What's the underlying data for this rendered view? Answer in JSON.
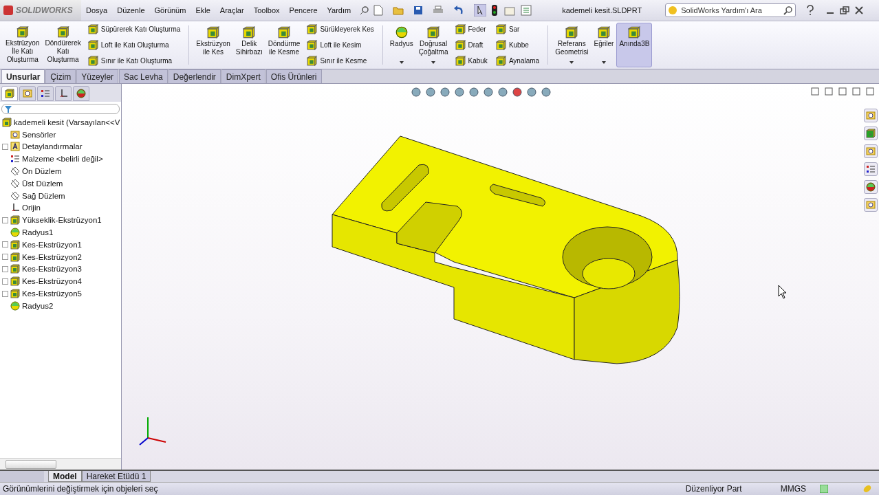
{
  "app": {
    "logo": "SOLIDWORKS"
  },
  "menu": [
    "Dosya",
    "Düzenle",
    "Görünüm",
    "Ekle",
    "Araçlar",
    "Toolbox",
    "Pencere",
    "Yardım"
  ],
  "document_title": "kademeli kesit.SLDPRT",
  "search": {
    "placeholder": "SolidWorks Yardım'ı Ara"
  },
  "ribbon": [
    {
      "kind": "large",
      "label": "Ekstrüzyon\nİle Katı\nOluşturma",
      "selected": false
    },
    {
      "kind": "large",
      "label": "Döndürerek\nKatı\nOluşturma",
      "selected": false
    },
    {
      "kind": "stack",
      "items": [
        "Süpürerek Katı Oluşturma",
        "Loft ile Katı Oluşturma",
        "Sınır ile Katı Oluşturma"
      ]
    },
    {
      "kind": "separator"
    },
    {
      "kind": "large",
      "label": "Ekstrüzyon\nile Kes",
      "selected": false
    },
    {
      "kind": "large",
      "label": "Delik\nSihirbazı",
      "selected": false
    },
    {
      "kind": "large",
      "label": "Döndürme\nile Kesme",
      "selected": false
    },
    {
      "kind": "stack",
      "items": [
        "Sürükleyerek Kes",
        "Loft ile Kesim",
        "Sınır ile Kesme"
      ]
    },
    {
      "kind": "separator"
    },
    {
      "kind": "dropdown",
      "label": "Radyus",
      "selected": false
    },
    {
      "kind": "dropdown",
      "label": "Doğrusal\nÇoğaltma",
      "selected": false
    },
    {
      "kind": "stack",
      "items": [
        "Feder",
        "Draft",
        "Kabuk"
      ]
    },
    {
      "kind": "stack",
      "items": [
        "Sar",
        "Kubbe",
        "Aynalama"
      ]
    },
    {
      "kind": "separator"
    },
    {
      "kind": "dropdown",
      "label": "Referans\nGeometrisi",
      "selected": false
    },
    {
      "kind": "dropdown",
      "label": "Eğriler",
      "selected": false
    },
    {
      "kind": "large",
      "label": "Anında3B",
      "selected": true
    }
  ],
  "command_tabs": [
    {
      "label": "Unsurlar",
      "selected": true
    },
    {
      "label": "Çizim",
      "selected": false
    },
    {
      "label": "Yüzeyler",
      "selected": false
    },
    {
      "label": "Sac Levha",
      "selected": false
    },
    {
      "label": "Değerlendir",
      "selected": false
    },
    {
      "label": "DimXpert",
      "selected": false
    },
    {
      "label": "Ofis Ürünleri",
      "selected": false
    }
  ],
  "tree": {
    "root": "kademeli kesit  (Varsayılan<<V",
    "children": [
      {
        "kind": "sensor",
        "label": "Sensörler",
        "expandable": false
      },
      {
        "kind": "annotation",
        "label": "Detaylandırmalar",
        "expandable": true
      },
      {
        "kind": "material",
        "label": "Malzeme <belirli değil>",
        "expandable": false
      },
      {
        "kind": "plane",
        "label": "Ön Düzlem",
        "expandable": false
      },
      {
        "kind": "plane",
        "label": "Üst Düzlem",
        "expandable": false
      },
      {
        "kind": "plane",
        "label": "Sağ Düzlem",
        "expandable": false
      },
      {
        "kind": "origin",
        "label": "Orijin",
        "expandable": false
      },
      {
        "kind": "boss",
        "label": "Yükseklik-Ekstrüzyon1",
        "expandable": true
      },
      {
        "kind": "fillet",
        "label": "Radyus1",
        "expandable": false
      },
      {
        "kind": "cut",
        "label": "Kes-Ekstrüzyon1",
        "expandable": true
      },
      {
        "kind": "cut",
        "label": "Kes-Ekstrüzyon2",
        "expandable": true
      },
      {
        "kind": "cut",
        "label": "Kes-Ekstrüzyon3",
        "expandable": true
      },
      {
        "kind": "cut",
        "label": "Kes-Ekstrüzyon4",
        "expandable": true
      },
      {
        "kind": "cut",
        "label": "Kes-Ekstrüzyon5",
        "expandable": true
      },
      {
        "kind": "fillet",
        "label": "Radyus2",
        "expandable": false
      }
    ]
  },
  "model_tabs": [
    {
      "label": "Model",
      "selected": true
    },
    {
      "label": "Hareket Etüdü 1",
      "selected": false
    }
  ],
  "status_bar": {
    "message": "Görünümlerini değiştirmek için objeleri seç",
    "mode": "Düzenliyor Part",
    "units": "MMGS"
  }
}
